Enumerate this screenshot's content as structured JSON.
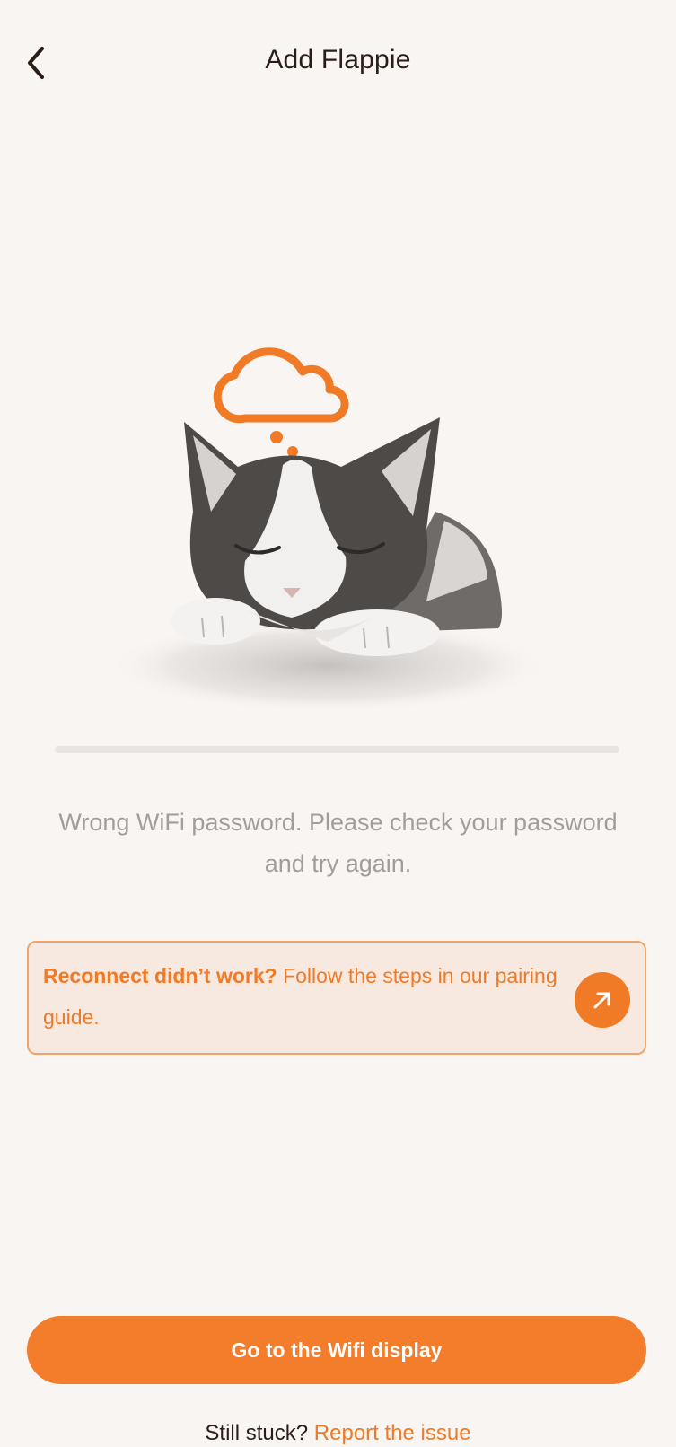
{
  "header": {
    "title": "Add Flappie",
    "back_icon": "chevron-left-icon"
  },
  "illustration": {
    "subject": "sleeping cat with thought cloud",
    "accent_color": "#f07a26"
  },
  "progress": {
    "track_color": "#ebe5e1"
  },
  "message": {
    "text": "Wrong WiFi password. Please check your password and try again."
  },
  "guide_card": {
    "bold_text": "Reconnect didn’t work?",
    "text": "Follow the steps in our pairing guide.",
    "arrow_icon": "arrow-up-right-icon",
    "border_color": "#f0a467",
    "background_color": "#f7e8e0"
  },
  "primary_button": {
    "label": "Go to the Wifi display",
    "color": "#f37d2a"
  },
  "footer": {
    "prefix": "Still stuck?",
    "link_label": "Report the issue"
  }
}
